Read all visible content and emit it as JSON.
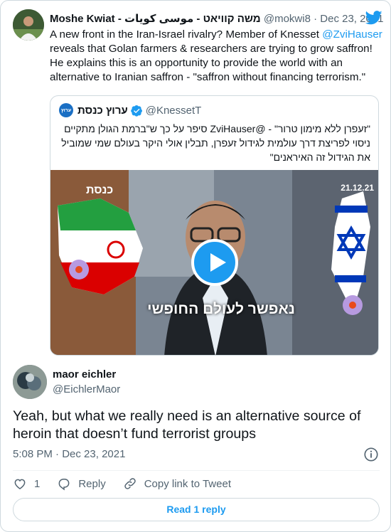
{
  "parent_tweet": {
    "author_name": "Moshe Kwiat - משה קוויאט - موسى كويات",
    "handle": "@mokwi8",
    "separator": "·",
    "date": "Dec 23, 2021",
    "text_part1": "A new front in the Iran-Israel rivalry? Member of Knesset ",
    "mention": "@ZviHauser",
    "text_part2": " reveals that Golan farmers & researchers are trying to grow saffron! He explains this is an opportunity to provide the world with an alternative to Iranian saffron - \"saffron without financing terrorism.\""
  },
  "quoted_tweet": {
    "avatar_text": "ערוץ",
    "author_name": "ערוץ כנסת",
    "handle": "@KnessetT",
    "text": "\"זעפרן ללא מימון טרור\" - @ZviHauser סיפר על כך ש\"ברמת הגולן מתקיים ניסוי לפריצת דרך עולמית לגידול זעפרן, תבלין אולי היקר בעולם שמי שמוביל את הגידול זה האיראנים\"",
    "media": {
      "overlay_logo": "כנסת",
      "overlay_date": "21.12.21",
      "caption": "נאפשר לעולם החופשי"
    }
  },
  "main_tweet": {
    "author_name": "maor eichler",
    "handle": "@EichlerMaor",
    "text": "Yeah, but what we really need is an alternative source of heroin that doesn’t fund terrorist groups",
    "time": "5:08 PM",
    "separator": "·",
    "date": "Dec 23, 2021",
    "likes": "1",
    "reply_label": "Reply",
    "copy_link_label": "Copy link to Tweet",
    "read_replies_label": "Read 1 reply"
  },
  "colors": {
    "accent": "#1d9bf0",
    "text": "#0f1419",
    "secondary": "#536471",
    "border": "#cfd9de"
  }
}
